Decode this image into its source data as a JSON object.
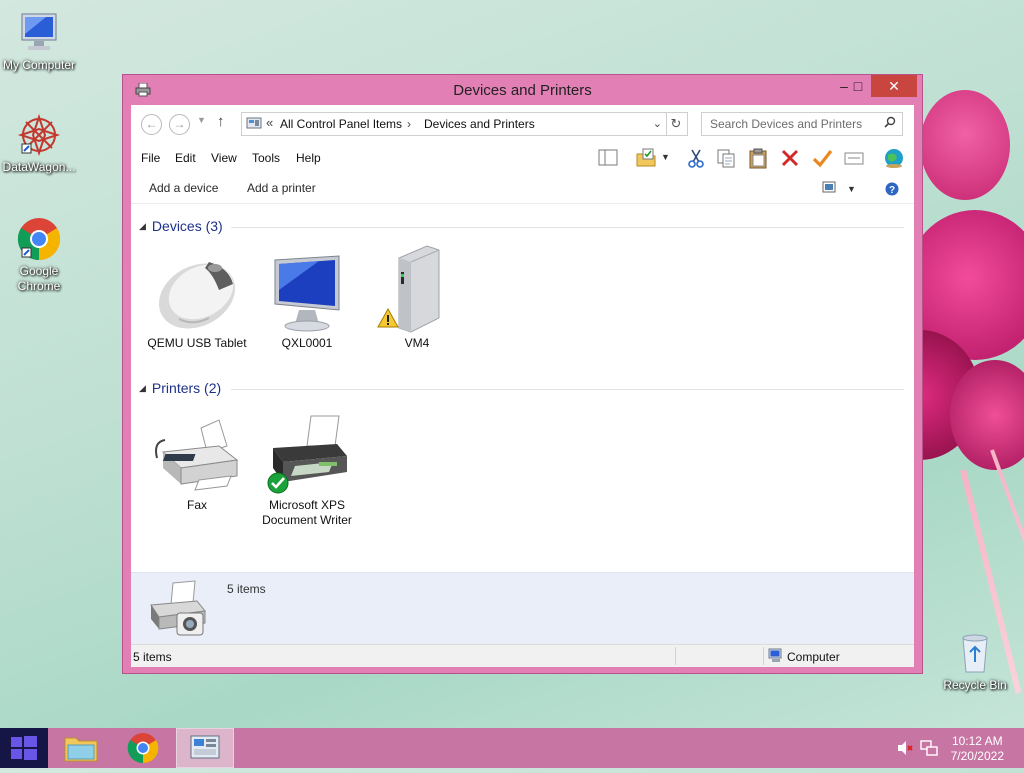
{
  "desktop": {
    "icons": [
      {
        "label": "My Computer",
        "icon": "computer-icon"
      },
      {
        "label": "DataWagon...",
        "icon": "datawagon-icon"
      },
      {
        "label": "Google Chrome",
        "icon": "chrome-icon"
      },
      {
        "label": "Recycle Bin",
        "icon": "recycle-bin-icon"
      }
    ]
  },
  "window": {
    "title": "Devices and Printers",
    "controls": {
      "minimize": "–",
      "maximize": "□",
      "close": "✕"
    },
    "address": {
      "prefix": "«",
      "crumbs": [
        "All Control Panel Items",
        "Devices and Printers"
      ],
      "separator": "›"
    },
    "search": {
      "placeholder": "Search Devices and Printers",
      "value": ""
    },
    "menu": [
      "File",
      "Edit",
      "View",
      "Tools",
      "Help"
    ],
    "toolbar_icons": [
      "preview-pane-icon",
      "properties-icon",
      "dropdown-icon",
      "cut-icon",
      "copy-icon",
      "paste-icon",
      "delete-icon",
      "checkmark-icon",
      "rename-icon",
      "globe-icon"
    ],
    "commands": {
      "add_device": "Add a device",
      "add_printer": "Add a printer"
    },
    "groups": [
      {
        "title": "Devices (3)",
        "items": [
          {
            "name": "QEMU USB Tablet",
            "icon": "mouse-icon",
            "warning": false
          },
          {
            "name": "QXL0001",
            "icon": "monitor-icon",
            "warning": false
          },
          {
            "name": "VM4",
            "icon": "external-drive-icon",
            "warning": true
          }
        ]
      },
      {
        "title": "Printers (2)",
        "items": [
          {
            "name": "Fax",
            "icon": "fax-icon",
            "default": false
          },
          {
            "name": "Microsoft XPS Document Writer",
            "icon": "printer-icon",
            "default": true
          }
        ]
      }
    ],
    "details": {
      "count": "5 items"
    },
    "statusbar": {
      "left": "5 items",
      "right": "Computer"
    }
  },
  "taskbar": {
    "apps": [
      "file-explorer-icon",
      "chrome-icon",
      "control-panel-icon"
    ],
    "clock": {
      "time": "10:12 AM",
      "date": "7/20/2022"
    }
  },
  "colors": {
    "window_frame": "#e27fb5",
    "close_button": "#c9453f",
    "taskbar": "#c776a4",
    "start": "#161646",
    "group_header": "#1e3287"
  }
}
